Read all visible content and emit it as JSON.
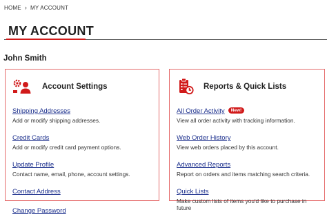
{
  "breadcrumb": {
    "home": "HOME",
    "separator": "›",
    "current": "MY ACCOUNT"
  },
  "page_title": "MY ACCOUNT",
  "user_name": "John Smith",
  "colors": {
    "accent": "#d11a1a",
    "link": "#1a2e8c",
    "card_border": "#e56a6a"
  },
  "account_settings": {
    "title": "Account Settings",
    "icon": "account-settings-icon",
    "items": [
      {
        "label": "Shipping Addresses",
        "desc": "Add or modify shipping addresses."
      },
      {
        "label": "Credit Cards",
        "desc": "Add or modify credit card payment options."
      },
      {
        "label": "Update Profile",
        "desc": "Contact name, email, phone, account settings."
      },
      {
        "label": "Contact Address",
        "desc": ""
      },
      {
        "label": "Change Password",
        "desc": ""
      }
    ]
  },
  "reports": {
    "title": "Reports & Quick Lists",
    "icon": "reports-clipboard-icon",
    "items": [
      {
        "label": "All Order Activity",
        "badge": "New!",
        "desc": "View all order activity with tracking information."
      },
      {
        "label": "Web Order History",
        "desc": "View web orders placed by this account."
      },
      {
        "label": "Advanced Reports",
        "desc": "Report on orders and items matching search criteria."
      },
      {
        "label": "Quick Lists",
        "desc": "Make custom lists of items you'd like to purchase in future"
      }
    ]
  }
}
